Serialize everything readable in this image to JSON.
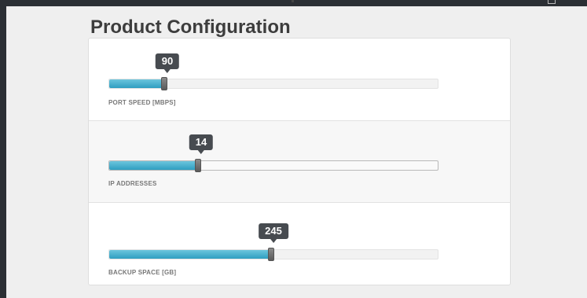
{
  "page": {
    "title": "Product Configuration"
  },
  "sliders": [
    {
      "label": "PORT SPEED [MBPS]",
      "value": "90",
      "fill_fraction": 0.17,
      "outlined": false
    },
    {
      "label": "IP ADDRESSES",
      "value": "14",
      "fill_fraction": 0.27,
      "outlined": true
    },
    {
      "label": "BACKUP SPACE [GB]",
      "value": "245",
      "fill_fraction": 0.49,
      "outlined": false
    }
  ],
  "colors": {
    "fill": "#2f9ec0",
    "bubble": "#474b50",
    "background": "#2b2f34"
  }
}
